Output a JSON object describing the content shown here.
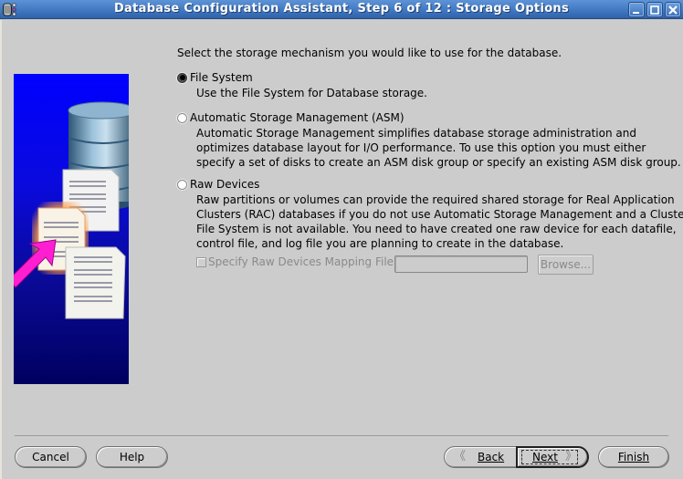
{
  "window": {
    "title": "Database Configuration Assistant, Step 6 of 12 : Storage Options",
    "app_icon": "database-icon",
    "controls": {
      "minimize": "minimize-icon",
      "maximize": "maximize-icon",
      "close": "close-icon"
    }
  },
  "illustration": {
    "semantic": "database-and-files-illustration"
  },
  "main": {
    "intro": "Select the storage mechanism you would like to use for the database.",
    "options": [
      {
        "label": "File System",
        "selected": true,
        "description": [
          "Use the File System for Database storage."
        ]
      },
      {
        "label": "Automatic Storage Management (ASM)",
        "selected": false,
        "description": [
          "Automatic Storage Management simplifies database storage administration and",
          "optimizes database layout for I/O performance. To use this option you must either",
          "specify a set of disks to create an ASM disk group or specify an existing ASM disk group."
        ]
      },
      {
        "label": "Raw Devices",
        "selected": false,
        "description": [
          "Raw partitions or volumes can provide the required shared storage for Real Application",
          "Clusters (RAC) databases if you do not use Automatic Storage Management and a Cluster",
          "File System is not available.  You need to have created one raw device for each datafile,",
          "control file, and log file you are planning to create in the database."
        ]
      }
    ],
    "raw_mapping": {
      "checkbox_label": "Specify Raw Devices Mapping File",
      "checked": false,
      "enabled": false,
      "field_value": "",
      "browse_label": "Browse..."
    }
  },
  "footer": {
    "cancel": "Cancel",
    "help": "Help",
    "back": "Back",
    "next": "Next",
    "finish": "Finish",
    "back_icon": "chevron-left-icon",
    "next_icon": "chevron-right-icon"
  }
}
